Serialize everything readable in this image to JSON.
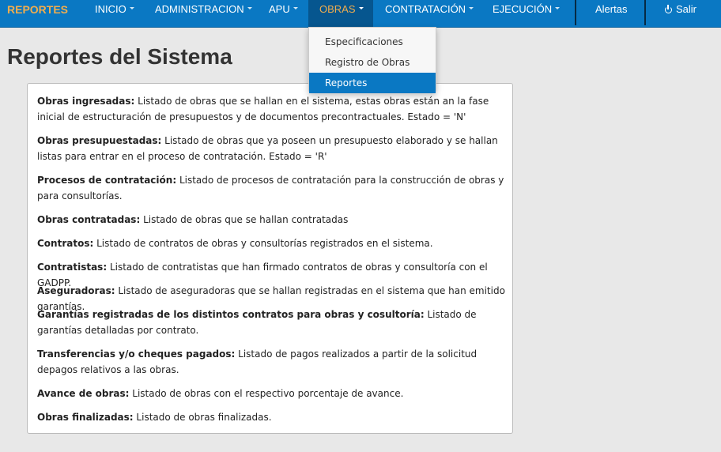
{
  "navbar": {
    "brand": "REPORTES",
    "items": [
      {
        "label": "INICIO"
      },
      {
        "label": "ADMINISTRACION"
      },
      {
        "label": "APU"
      },
      {
        "label": "OBRAS"
      },
      {
        "label": "CONTRATACIÓN"
      },
      {
        "label": "EJECUCIÓN"
      }
    ],
    "alerts": "Alertas",
    "logout": "Salir",
    "logout_icon": "power-icon",
    "colors": {
      "bar": "#0a78c3",
      "active": "#06568f",
      "brand": "#f0ad4e"
    }
  },
  "dropdown": {
    "items": [
      "Especificaciones",
      "Registro de Obras",
      "Reportes"
    ],
    "active_item": "Reportes"
  },
  "page": {
    "title": "Reportes del Sistema"
  },
  "reports": [
    {
      "name": "Obras ingresadas:",
      "desc": " Listado de obras que se hallan en el sistema, estas obras están an la fase inicial de estructuración de presupuestos y de documentos precontractuales. Estado = 'N'"
    },
    {
      "name": "Obras presupuestadas:",
      "desc": " Listado de obras que ya poseen un presupuesto elaborado y se hallan listas para entrar en el proceso de contratación. Estado = 'R'"
    },
    {
      "name": "Procesos de contratación:",
      "desc": " Listado de procesos de contratación para la construcción de obras y para consultorías."
    },
    {
      "name": "Obras contratadas:",
      "desc": " Listado de obras que se hallan contratadas"
    },
    {
      "name": "Contratos:",
      "desc": " Listado de contratos de obras y consultorías registrados en el sistema."
    },
    {
      "name": "Contratistas:",
      "desc": " Listado de contratistas que han firmado contratos de obras y consultoría con el GADPP."
    },
    {
      "name": "Aseguradoras:",
      "desc": " Listado de aseguradoras que se hallan registradas en el sistema que han emitido garantías."
    },
    {
      "name": "Garantías registradas de los distintos contratos para obras y cosultoría:",
      "desc": " Listado de garantías detalladas por contrato."
    },
    {
      "name": "Transferencias y/o cheques pagados:",
      "desc": " Listado de pagos realizados a partir de la solicitud depagos relativos a las obras."
    },
    {
      "name": "Avance de obras:",
      "desc": " Listado de obras con el respectivo porcentaje de avance."
    },
    {
      "name": "Obras finalizadas:",
      "desc": " Listado de obras finalizadas."
    }
  ]
}
